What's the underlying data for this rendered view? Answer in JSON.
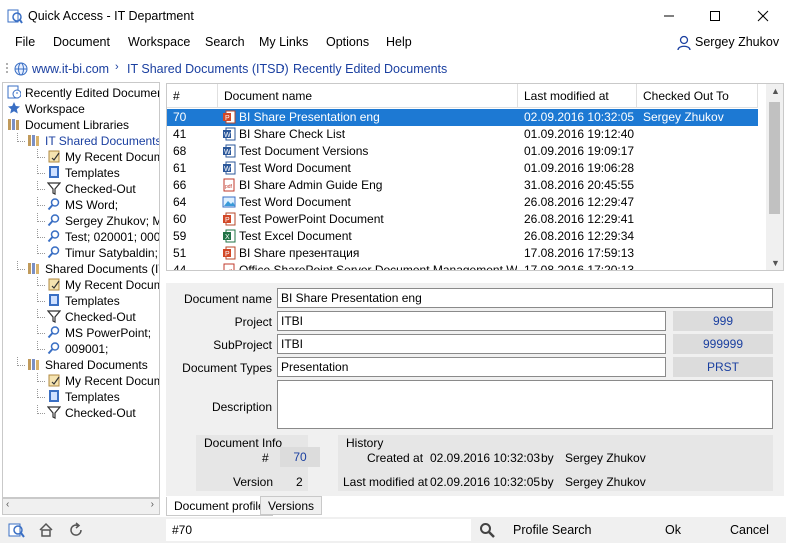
{
  "window": {
    "title": "Quick Access - IT Department"
  },
  "menu": {
    "items": [
      "File",
      "Document",
      "Workspace",
      "Search",
      "My Links",
      "Options",
      "Help"
    ],
    "user": "Sergey Zhukov"
  },
  "breadcrumb": [
    "www.it-bi.com",
    "IT Shared Documents (ITSD)",
    "Recently Edited Documents"
  ],
  "tree": [
    {
      "label": "Recently Edited Documents",
      "icon": "recent-docs-icon",
      "level": 0,
      "color": "#000"
    },
    {
      "label": "Workspace",
      "icon": "star-icon",
      "level": 0,
      "color": "#000"
    },
    {
      "label": "Document Libraries",
      "icon": "library-icon",
      "level": 0,
      "color": "#000"
    },
    {
      "label": "IT Shared Documents (I",
      "icon": "library-folder-icon",
      "level": 1,
      "color": "#1a3fa0"
    },
    {
      "label": "My Recent Docume",
      "icon": "recent-edit-icon",
      "level": 2,
      "color": "#000"
    },
    {
      "label": "Templates",
      "icon": "template-icon",
      "level": 2,
      "color": "#000"
    },
    {
      "label": "Checked-Out",
      "icon": "funnel-icon",
      "level": 2,
      "color": "#000"
    },
    {
      "label": "MS Word;",
      "icon": "magnifier-icon",
      "level": 2,
      "color": "#000"
    },
    {
      "label": "Sergey Zhukov; MS",
      "icon": "magnifier-icon",
      "level": 2,
      "color": "#000"
    },
    {
      "label": "Test; 020001; 00000",
      "icon": "magnifier-icon",
      "level": 2,
      "color": "#000"
    },
    {
      "label": "Timur Satybaldin;",
      "icon": "magnifier-icon",
      "level": 2,
      "color": "#000"
    },
    {
      "label": "Shared Documents (ITB",
      "icon": "library-folder-icon",
      "level": 1,
      "color": "#000"
    },
    {
      "label": "My Recent Docume",
      "icon": "recent-edit-icon",
      "level": 2,
      "color": "#000"
    },
    {
      "label": "Templates",
      "icon": "template-icon",
      "level": 2,
      "color": "#000"
    },
    {
      "label": "Checked-Out",
      "icon": "funnel-icon",
      "level": 2,
      "color": "#000"
    },
    {
      "label": "MS PowerPoint;",
      "icon": "magnifier-icon",
      "level": 2,
      "color": "#000"
    },
    {
      "label": "009001;",
      "icon": "magnifier-icon",
      "level": 2,
      "color": "#000"
    },
    {
      "label": "Shared Documents",
      "icon": "library-folder-icon",
      "level": 1,
      "color": "#000"
    },
    {
      "label": "My Recent Docume",
      "icon": "recent-edit-icon",
      "level": 2,
      "color": "#000"
    },
    {
      "label": "Templates",
      "icon": "template-icon",
      "level": 2,
      "color": "#000"
    },
    {
      "label": "Checked-Out",
      "icon": "funnel-icon",
      "level": 2,
      "color": "#000"
    }
  ],
  "grid": {
    "columns": [
      "#",
      "Document name",
      "Last modified at",
      "Checked Out To"
    ],
    "rows": [
      {
        "num": "70",
        "icon": "powerpoint-icon",
        "name": "BI Share Presentation eng",
        "modified": "02.09.2016 10:32:05",
        "checked": "Sergey Zhukov",
        "selected": true
      },
      {
        "num": "41",
        "icon": "word-icon",
        "name": "BI Share Check List",
        "modified": "01.09.2016 19:12:40",
        "checked": "",
        "selected": false
      },
      {
        "num": "68",
        "icon": "word-icon",
        "name": "Test Document Versions",
        "modified": "01.09.2016 19:09:17",
        "checked": "",
        "selected": false
      },
      {
        "num": "61",
        "icon": "word-icon",
        "name": "Test Word Document",
        "modified": "01.09.2016 19:06:28",
        "checked": "",
        "selected": false
      },
      {
        "num": "66",
        "icon": "pdf-icon",
        "name": "BI Share Admin Guide Eng",
        "modified": "31.08.2016 20:45:55",
        "checked": "",
        "selected": false
      },
      {
        "num": "64",
        "icon": "image-icon",
        "name": "Test Word Document",
        "modified": "26.08.2016 12:29:47",
        "checked": "",
        "selected": false
      },
      {
        "num": "60",
        "icon": "powerpoint-icon",
        "name": "Test PowerPoint Document",
        "modified": "26.08.2016 12:29:41",
        "checked": "",
        "selected": false
      },
      {
        "num": "59",
        "icon": "excel-icon",
        "name": "Test Excel Document",
        "modified": "26.08.2016 12:29:34",
        "checked": "",
        "selected": false
      },
      {
        "num": "51",
        "icon": "powerpoint-icon",
        "name": "BI Share презентация",
        "modified": "17.08.2016 17:59:13",
        "checked": "",
        "selected": false
      },
      {
        "num": "44",
        "icon": "pdf-icon",
        "name": "Office SharePoint Server Document Management White",
        "modified": "17.08.2016 17:20:13",
        "checked": "",
        "selected": false
      }
    ]
  },
  "details": {
    "document_name_label": "Document name",
    "document_name": "BI Share Presentation eng",
    "project_label": "Project",
    "project": "ITBI",
    "project_code": "999",
    "subproject_label": "SubProject",
    "subproject": "ITBI",
    "subproject_code": "999999",
    "doctype_label": "Document Types",
    "doctype": "Presentation",
    "doctype_code": "PRST",
    "description_label": "Description",
    "description": "",
    "info_label": "Document Info",
    "num_label": "#",
    "num": "70",
    "version_label": "Version",
    "version": "2",
    "history_label": "History",
    "created_label": "Created at",
    "created": "02.09.2016 10:32:03",
    "created_by_label": "by",
    "created_by": "Sergey Zhukov",
    "modified_label": "Last modified at",
    "modified": "02.09.2016 10:32:05",
    "modified_by_label": "by",
    "modified_by": "Sergey Zhukov"
  },
  "tabs": [
    "Document profile",
    "Versions"
  ],
  "bottom": {
    "search_value": "#70",
    "profile_search": "Profile Search",
    "ok": "Ok",
    "cancel": "Cancel"
  },
  "colors": {
    "accent": "#1d79d3",
    "link": "#1a3fa0",
    "panel": "#f0f0f0"
  }
}
